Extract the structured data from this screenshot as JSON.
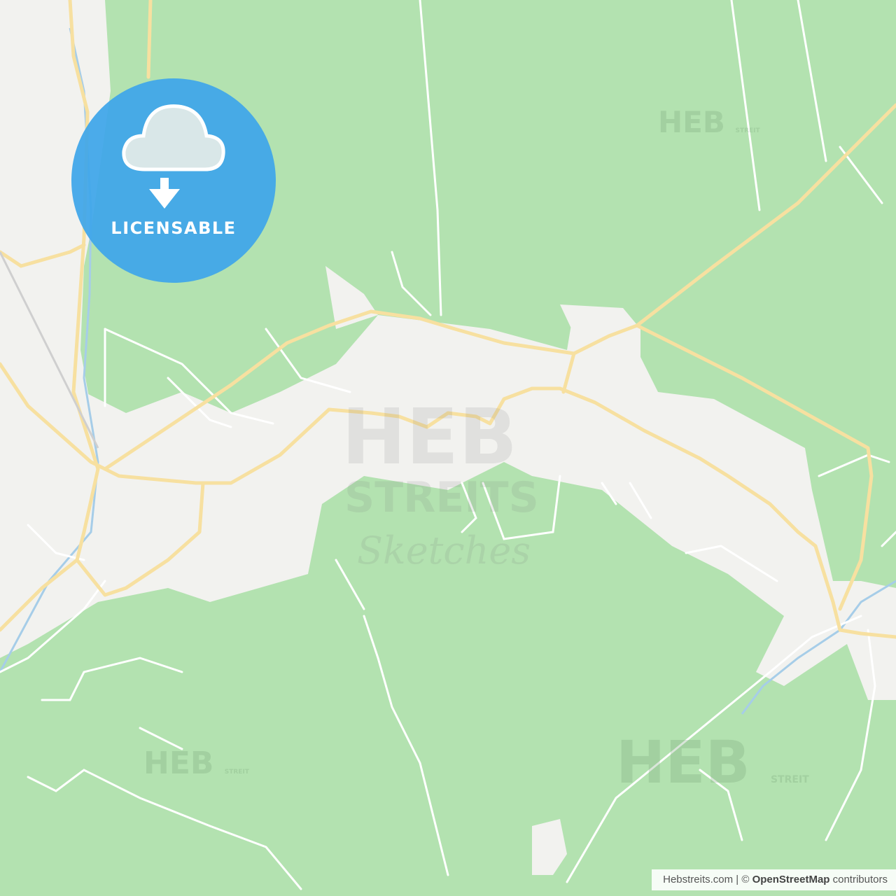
{
  "badge": {
    "label": "LICENSABLE",
    "icon": "cloud-download-icon",
    "color": "#3ea6e9"
  },
  "watermarks": {
    "brand": "HEB",
    "brand_sub": "STREIT",
    "center_top": "HEB",
    "center_bottom": "STREITS",
    "center_script": "Sketches"
  },
  "attribution": {
    "site": "Hebstreits.com",
    "separator": " | © ",
    "osm": "OpenStreetMap",
    "suffix": " contributors"
  },
  "colors": {
    "forest": "#b3e2b0",
    "urban": "#f2f2ef",
    "road_major": "#f7e0a0",
    "road_minor": "#ffffff",
    "water": "#a6cde8"
  }
}
